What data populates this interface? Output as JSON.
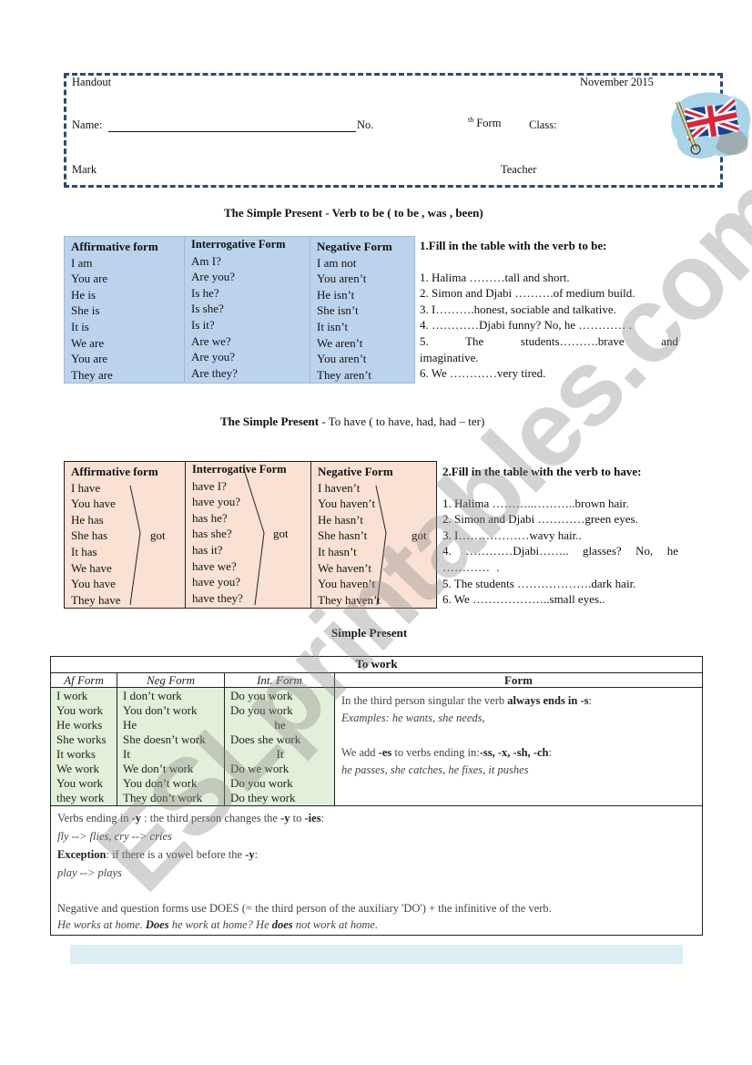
{
  "header": {
    "handout_label": "Handout",
    "date": "November 2015",
    "name_label": "Name:",
    "number_label": "No.",
    "form_superscript": "th",
    "form_label": "Form",
    "class_label": "Class:",
    "mark_label": "Mark",
    "teacher_label": "Teacher",
    "flag_image": "union-jack-flag-clipart"
  },
  "section_be": {
    "title": "The Simple Present - Verb to be ( to be , was , been)",
    "table": {
      "columns": [
        {
          "heading": "Affirmative form",
          "rows": [
            "I am",
            "You are",
            "He is",
            "She is",
            "It is",
            "We are",
            "You are",
            "They are"
          ]
        },
        {
          "heading": "Interrogative Form",
          "rows": [
            "Am I?",
            "Are you?",
            "Is he?",
            "Is she?",
            "Is it?",
            "Are we?",
            "Are you?",
            "Are they?"
          ]
        },
        {
          "heading": "Negative Form",
          "rows": [
            "I am not",
            "You aren’t",
            "He isn’t",
            "She isn’t",
            "It isn’t",
            "We aren’t",
            "You aren’t",
            "They aren’t"
          ]
        }
      ]
    },
    "exercise": {
      "title": "1.Fill in the table with the  verb to be:",
      "items": [
        "1. Halima ………tall and short.",
        "2. Simon and Djabi ……….of medium build.",
        "3. I……….honest, sociable and talkative.",
        "4. …………Djabi funny? No, he ………… .",
        "5. The students……….brave and imaginative.",
        "6. We …………very tired."
      ]
    }
  },
  "section_have": {
    "title_bold": "The Simple Present",
    "title_rest": " - To have ( to have, had, had – ter)",
    "got_label": "got",
    "table": {
      "columns": [
        {
          "heading": "Affirmative form",
          "rows": [
            "I have",
            "You have",
            "He has",
            "She has",
            "It has",
            "We have",
            "You have",
            "They have"
          ]
        },
        {
          "heading": "Interrogative Form",
          "rows": [
            "have I?",
            "have you?",
            "has he?",
            "has she?",
            "has it?",
            "have we?",
            "have you?",
            "have they?"
          ]
        },
        {
          "heading": "Negative Form",
          "rows": [
            "I haven’t",
            "You haven’t",
            "He hasn’t",
            "She hasn’t",
            "It hasn’t",
            "We haven’t",
            "You haven’t",
            "They haven’t"
          ]
        }
      ]
    },
    "exercise": {
      "title": "2.Fill in the table with the verb to have:",
      "items": [
        "1. Halima ………..………..brown hair.",
        "2. Simon and Djabi …………green eyes.",
        "3. I………………wavy hair..",
        "4.  …………Djabi……..  glasses?  No,  he ………… .",
        "5. The students ……………….dark hair.",
        "6. We ………………..small eyes.."
      ]
    }
  },
  "section_work": {
    "title": "Simple Present",
    "table_title": "To work",
    "headers": {
      "affirmative": "Af  Form",
      "negative": "Neg Form",
      "interrogative": "Int. Form",
      "form": "Form"
    },
    "affirmative": [
      "I work",
      "You work",
      "He works",
      "She works",
      "It works",
      "We work",
      "You work",
      "they work"
    ],
    "negative": [
      "I don’t work",
      "You don’t work",
      "He",
      "She doesn’t work",
      "It",
      "We don’t work",
      "You don’t work",
      "They don’t work"
    ],
    "interrogative": [
      "Do you work",
      "Do you work",
      "he",
      "Does she work",
      "It",
      "Do we work",
      "Do you work",
      "Do they work"
    ],
    "form_rules": {
      "rule1_prefix": "In the third person singular the verb ",
      "rule1_bold": "always ends in -s",
      "rule1_suffix": ":",
      "rule1_examples": "Examples:  he wants, she needs,",
      "rule2_prefix": "We add ",
      "rule2_bold1": "-es",
      "rule2_mid": " to verbs ending in:",
      "rule2_bold2": "-ss, -x, -sh, -ch",
      "rule2_suffix": ":",
      "rule2_examples": "he passes, she catches, he fixes, it pushes"
    },
    "notes": {
      "y_rule_prefix": "Verbs ending in ",
      "y_rule_bold1": "-y",
      "y_rule_mid": " : the third person changes the ",
      "y_rule_bold2": "-y",
      "y_rule_mid2": " to ",
      "y_rule_bold3": "-ies",
      "y_rule_suffix": ":",
      "y_examples": "fly --> flies,  cry --> cries",
      "exception_bold": "Exception",
      "exception_text": ": if there is a vowel before the ",
      "exception_bold2": "-y",
      "exception_suffix": ":",
      "exception_example": "play --> plays",
      "does_rule": "Negative and question forms use DOES (= the third person of the auxiliary 'DO') + the infinitive of the verb.",
      "does_example_1": "He works at home.  ",
      "does_example_bold1": "Does",
      "does_example_2": " he work at home? He ",
      "does_example_bold2": "does",
      "does_example_3": " not work at home."
    }
  },
  "watermark": "ESLprintables.com"
}
